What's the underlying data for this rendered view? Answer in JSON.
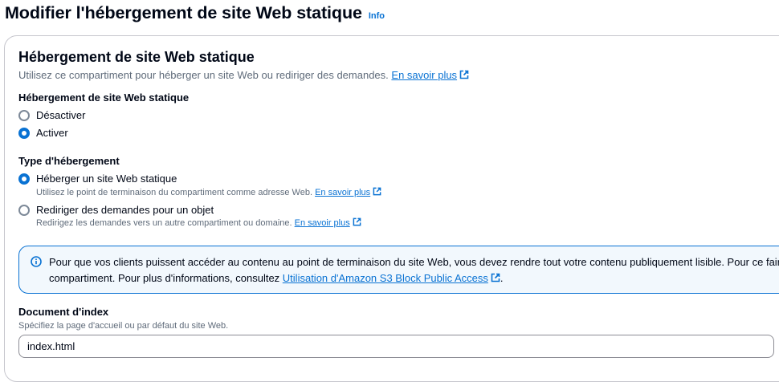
{
  "page": {
    "title": "Modifier l'hébergement de site Web statique",
    "info_label": "Info"
  },
  "container": {
    "title": "Hébergement de site Web statique",
    "description": "Utilisez ce compartiment pour héberger un site Web ou rediriger des demandes.",
    "learn_more": "En savoir plus"
  },
  "static_hosting": {
    "label": "Hébergement de site Web statique",
    "options": [
      {
        "label": "Désactiver",
        "checked": false
      },
      {
        "label": "Activer",
        "checked": true
      }
    ]
  },
  "hosting_type": {
    "label": "Type d'hébergement",
    "options": [
      {
        "label": "Héberger un site Web statique",
        "description": "Utilisez le point de terminaison du compartiment comme adresse Web.",
        "learn_more": "En savoir plus",
        "checked": true
      },
      {
        "label": "Rediriger des demandes pour un objet",
        "description": "Redirigez les demandes vers un autre compartiment ou domaine.",
        "learn_more": "En savoir plus",
        "checked": false
      }
    ]
  },
  "alert": {
    "line1": "Pour que vos clients puissent accéder au contenu au point de terminaison du site Web, vous devez rendre tout votre contenu publiquement lisible. Pour ce faire,",
    "line2_prefix": "compartiment. Pour plus d'informations, consultez",
    "link": "Utilisation d'Amazon S3 Block Public Access",
    "line2_suffix": "."
  },
  "index_document": {
    "label": "Document d'index",
    "description": "Spécifiez la page d'accueil ou par défaut du site Web.",
    "value": "index.html"
  },
  "colors": {
    "link": "#0972d3",
    "alert_background": "#f2f8fd",
    "alert_border": "#0972d3",
    "radio_checked": "#0972d3"
  }
}
